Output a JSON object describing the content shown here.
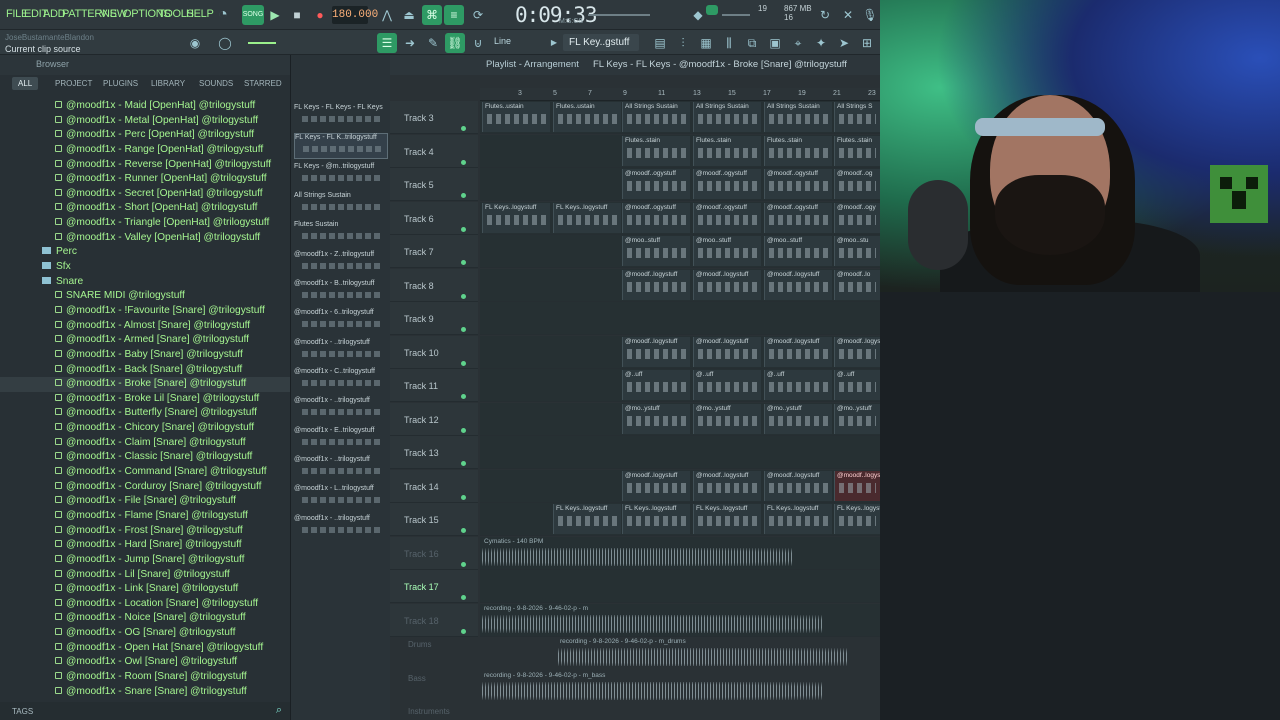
{
  "menu": [
    "FILE",
    "EDIT",
    "ADD",
    "PATTERNS",
    "VIEW",
    "OPTIONS",
    "TOOLS",
    "HELP"
  ],
  "transport": {
    "pat_song": "SONG",
    "tempo": "180.000",
    "time": "0:09:33",
    "time_sub": "M:S:CS",
    "voices": "19",
    "cpu": "867 MB",
    "cpu2": "16"
  },
  "hint": {
    "user": "JoseBustamanteBlandon",
    "text": "Current clip source"
  },
  "snap": "Line",
  "pattern_selector": "FL Key..gstuff",
  "browser": {
    "title": "Browser",
    "tabs": [
      "ALL",
      "PROJECT",
      "PLUGINS",
      "LIBRARY",
      "SOUNDS",
      "STARRED"
    ],
    "items": [
      {
        "type": "file",
        "label": "@moodf1x - Maid [OpenHat] @trilogystuff"
      },
      {
        "type": "file",
        "label": "@moodf1x - Metal [OpenHat] @trilogystuff"
      },
      {
        "type": "file",
        "label": "@moodf1x - Perc [OpenHat] @trilogystuff"
      },
      {
        "type": "file",
        "label": "@moodf1x - Range [OpenHat] @trilogystuff"
      },
      {
        "type": "file",
        "label": "@moodf1x - Reverse [OpenHat] @trilogystuff"
      },
      {
        "type": "file",
        "label": "@moodf1x - Runner [OpenHat] @trilogystuff"
      },
      {
        "type": "file",
        "label": "@moodf1x - Secret [OpenHat] @trilogystuff"
      },
      {
        "type": "file",
        "label": "@moodf1x - Short [OpenHat] @trilogystuff"
      },
      {
        "type": "file",
        "label": "@moodf1x - Triangle [OpenHat] @trilogystuff"
      },
      {
        "type": "file",
        "label": "@moodf1x - Valley [OpenHat] @trilogystuff"
      },
      {
        "type": "folder",
        "label": "Perc"
      },
      {
        "type": "folder",
        "label": "Sfx"
      },
      {
        "type": "folder",
        "label": "Snare"
      },
      {
        "type": "file",
        "label": "SNARE MIDI @trilogystuff"
      },
      {
        "type": "file",
        "label": "@moodf1x - !Favourite [Snare] @trilogystuff"
      },
      {
        "type": "file",
        "label": "@moodf1x - Almost [Snare] @trilogystuff"
      },
      {
        "type": "file",
        "label": "@moodf1x - Armed [Snare] @trilogystuff"
      },
      {
        "type": "file",
        "label": "@moodf1x - Baby [Snare] @trilogystuff"
      },
      {
        "type": "file",
        "label": "@moodf1x - Back [Snare] @trilogystuff"
      },
      {
        "type": "file",
        "label": "@moodf1x - Broke [Snare] @trilogystuff",
        "selected": true
      },
      {
        "type": "file",
        "label": "@moodf1x - Broke Lil [Snare] @trilogystuff"
      },
      {
        "type": "file",
        "label": "@moodf1x - Butterfly [Snare] @trilogystuff"
      },
      {
        "type": "file",
        "label": "@moodf1x - Chicory [Snare] @trilogystuff"
      },
      {
        "type": "file",
        "label": "@moodf1x - Claim [Snare] @trilogystuff"
      },
      {
        "type": "file",
        "label": "@moodf1x - Classic [Snare] @trilogystuff"
      },
      {
        "type": "file",
        "label": "@moodf1x - Command [Snare] @trilogystuff"
      },
      {
        "type": "file",
        "label": "@moodf1x - Corduroy [Snare] @trilogystuff"
      },
      {
        "type": "file",
        "label": "@moodf1x - File [Snare] @trilogystuff"
      },
      {
        "type": "file",
        "label": "@moodf1x - Flame [Snare] @trilogystuff"
      },
      {
        "type": "file",
        "label": "@moodf1x - Frost [Snare] @trilogystuff"
      },
      {
        "type": "file",
        "label": "@moodf1x - Hard [Snare] @trilogystuff"
      },
      {
        "type": "file",
        "label": "@moodf1x - Jump [Snare] @trilogystuff"
      },
      {
        "type": "file",
        "label": "@moodf1x - Lil [Snare] @trilogystuff"
      },
      {
        "type": "file",
        "label": "@moodf1x - Link [Snare] @trilogystuff"
      },
      {
        "type": "file",
        "label": "@moodf1x - Location [Snare] @trilogystuff"
      },
      {
        "type": "file",
        "label": "@moodf1x - Noice [Snare] @trilogystuff"
      },
      {
        "type": "file",
        "label": "@moodf1x - OG [Snare] @trilogystuff"
      },
      {
        "type": "file",
        "label": "@moodf1x - Open Hat [Snare] @trilogystuff"
      },
      {
        "type": "file",
        "label": "@moodf1x - Owl [Snare] @trilogystuff"
      },
      {
        "type": "file",
        "label": "@moodf1x - Room [Snare] @trilogystuff"
      },
      {
        "type": "file",
        "label": "@moodf1x - Snare [Snare] @trilogystuff"
      }
    ],
    "tags_label": "TAGS"
  },
  "picker": [
    "FL Keys - FL Keys - FL Keys",
    "FL Keys - FL K..trilogystuff",
    "FL Keys - @m..trilogystuff",
    "All Strings Sustain",
    "Flutes Sustain",
    "@moodf1x - Z..trilogystuff",
    "@moodf1x - B..trilogystuff",
    "@moodf1x - 6..trilogystuff",
    "@moodf1x - ..trilogystuff",
    "@moodf1x - C..trilogystuff",
    "@moodf1x - ..trilogystuff",
    "@moodf1x - E..trilogystuff",
    "@moodf1x - ..trilogystuff",
    "@moodf1x - L..trilogystuff",
    "@moodf1x - ..trilogystuff"
  ],
  "playlist": {
    "title": "Playlist - Arrangement",
    "path": "FL Keys - FL Keys - @moodf1x - Broke [Snare] @trilogystuff",
    "ticks": [
      "3",
      "5",
      "7",
      "9",
      "11",
      "13",
      "15",
      "17",
      "19",
      "21",
      "23"
    ],
    "tracks": [
      {
        "name": "Track 3",
        "clips": [
          {
            "label": "Flutes..ustain"
          },
          {
            "label": "Flutes..ustain"
          },
          {
            "label": "All Strings Sustain"
          },
          {
            "label": "All Strings Sustain"
          },
          {
            "label": "All Strings Sustain"
          },
          {
            "label": "All Strings S"
          }
        ]
      },
      {
        "name": "Track 4",
        "clips": [
          {
            "label": "Flutes..stain"
          },
          {
            "label": "Flutes..stain"
          },
          {
            "label": "Flutes..stain"
          },
          {
            "label": "Flutes..stain"
          }
        ]
      },
      {
        "name": "Track 5",
        "clips": [
          {
            "label": "@moodf..ogystuff"
          },
          {
            "label": "@moodf..ogystuff"
          },
          {
            "label": "@moodf..ogystuff"
          },
          {
            "label": "@moodf..og"
          }
        ]
      },
      {
        "name": "Track 6",
        "clips": [
          {
            "label": "FL Keys..logystuff"
          },
          {
            "label": "FL Keys..logystuff"
          },
          {
            "label": "@moodf..ogystuff"
          },
          {
            "label": "@moodf..ogystuff"
          },
          {
            "label": "@moodf..ogystuff"
          },
          {
            "label": "@moodf..ogy"
          }
        ]
      },
      {
        "name": "Track 7",
        "clips": [
          {
            "label": "@moo..stuff"
          },
          {
            "label": "@moo..stuff"
          },
          {
            "label": "@moo..stuff"
          },
          {
            "label": "@moo..stu"
          }
        ]
      },
      {
        "name": "Track 8",
        "clips": [
          {
            "label": "@moodf..logystuff"
          },
          {
            "label": "@moodf..logystuff"
          },
          {
            "label": "@moodf..logystuff"
          },
          {
            "label": "@moodf..lo"
          }
        ]
      },
      {
        "name": "Track 9",
        "clips": []
      },
      {
        "name": "Track 10",
        "clips": [
          {
            "label": "@moodf..logystuff"
          },
          {
            "label": "@moodf..logystuff"
          },
          {
            "label": "@moodf..logystuff"
          },
          {
            "label": "@moodf..logystuff"
          }
        ]
      },
      {
        "name": "Track 11",
        "clips": [
          {
            "label": "@..uff"
          },
          {
            "label": "@..uff"
          },
          {
            "label": "@..uff"
          },
          {
            "label": "@..uff"
          }
        ]
      },
      {
        "name": "Track 12",
        "clips": [
          {
            "label": "@mo..ystuff"
          },
          {
            "label": "@mo..ystuff"
          },
          {
            "label": "@mo..ystuff"
          },
          {
            "label": "@mo..ystuff"
          }
        ]
      },
      {
        "name": "Track 13",
        "clips": []
      },
      {
        "name": "Track 14",
        "clips": [
          {
            "label": "@moodf..logystuff"
          },
          {
            "label": "@moodf..logystuff"
          },
          {
            "label": "@moodf..logystuff"
          },
          {
            "label": "@moodf..logystuff"
          }
        ]
      },
      {
        "name": "Track 15",
        "clips": [
          {
            "label": "FL Keys..logystuff"
          },
          {
            "label": "FL Keys..logystuff"
          },
          {
            "label": "FL Keys..logystuff"
          },
          {
            "label": "FL Keys..logystuff"
          },
          {
            "label": "FL Keys..logystuff"
          }
        ]
      },
      {
        "name": "Track 16",
        "clips": []
      },
      {
        "name": "Track 17",
        "clips": []
      },
      {
        "name": "Track 18",
        "clips": []
      }
    ],
    "audio": [
      {
        "label": "Cymatics - 140 BPM"
      },
      {
        "label": "recording - 9-8-2026 - 9-46-02-p - m"
      },
      {
        "label": "recording - 9-8-2026 - 9-46-02-p - m_drums"
      },
      {
        "label": "recording - 9-8-2026 - 9-46-02-p - m_bass"
      }
    ],
    "side_labels": [
      "Drums",
      "Bass",
      "Instruments"
    ]
  }
}
